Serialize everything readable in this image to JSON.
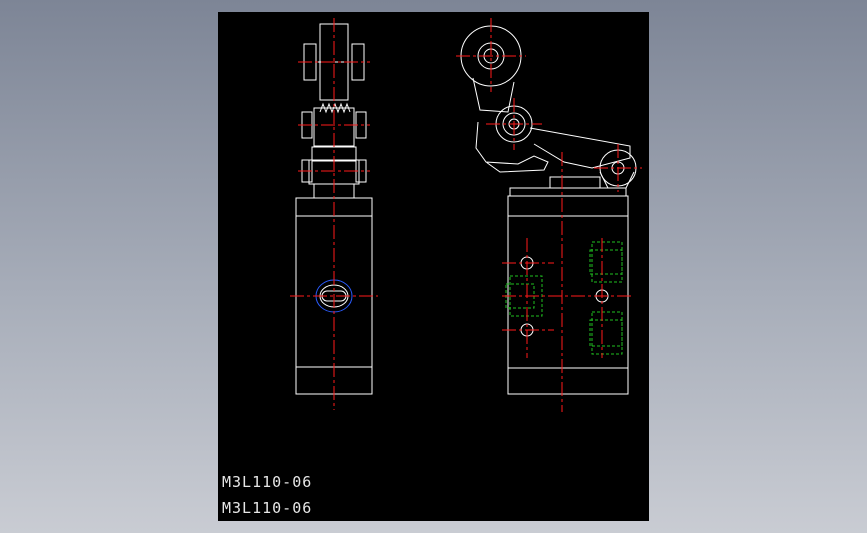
{
  "drawing": {
    "label_1": "M3L110-06",
    "label_2": "M3L110-06"
  },
  "colors": {
    "viewport_bg": "#000000",
    "outline": "#ffffff",
    "centerline": "#ff1a1a",
    "hidden_line": "#20c020",
    "port_ring": "#2a5cff"
  }
}
